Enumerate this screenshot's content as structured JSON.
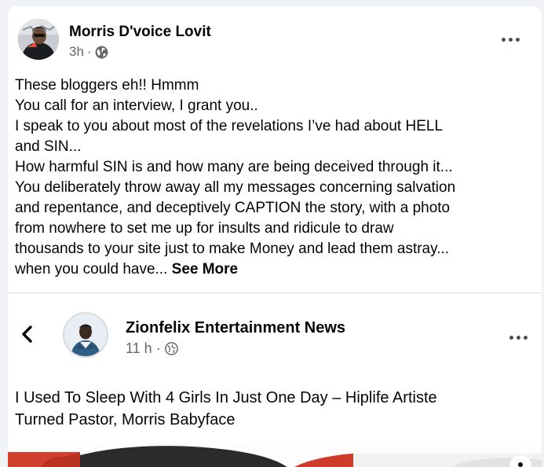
{
  "post": {
    "author": "Morris D'voice Lovit",
    "time": "3h",
    "separator": "·",
    "audience_icon": "globe-icon",
    "more_icon": "more-horizontal-icon",
    "text_lines": [
      "These bloggers eh!! Hmmm",
      "You call for an interview, I grant you..",
      "I speak to you about most of the revelations I’ve had about HELL",
      "and SIN...",
      "How harmful SIN is and how many are being deceived through it...",
      "You deliberately throw away all my messages concerning salvation",
      "and repentance, and deceptively CAPTION the story, with a photo",
      "from nowhere to set me up for insults and ridicule to draw",
      "thousands to your site just to make Money and lead them astray...",
      "when you could have..."
    ],
    "see_more": "See More"
  },
  "shared": {
    "back_icon": "chevron-left-icon",
    "page_name": "Zionfelix Entertainment News",
    "time": "11 h",
    "separator": "·",
    "audience_icon": "globe-icon",
    "more_icon": "more-horizontal-icon",
    "title_lines": [
      "I Used To Sleep With 4 Girls In Just One Day – Hiplife Artiste",
      "Turned Pastor, Morris Babyface"
    ]
  },
  "colors": {
    "background": "#f0f2f5",
    "card": "#ffffff",
    "primary_text": "#050505",
    "secondary_text": "#65676b",
    "divider": "#dadde1"
  }
}
